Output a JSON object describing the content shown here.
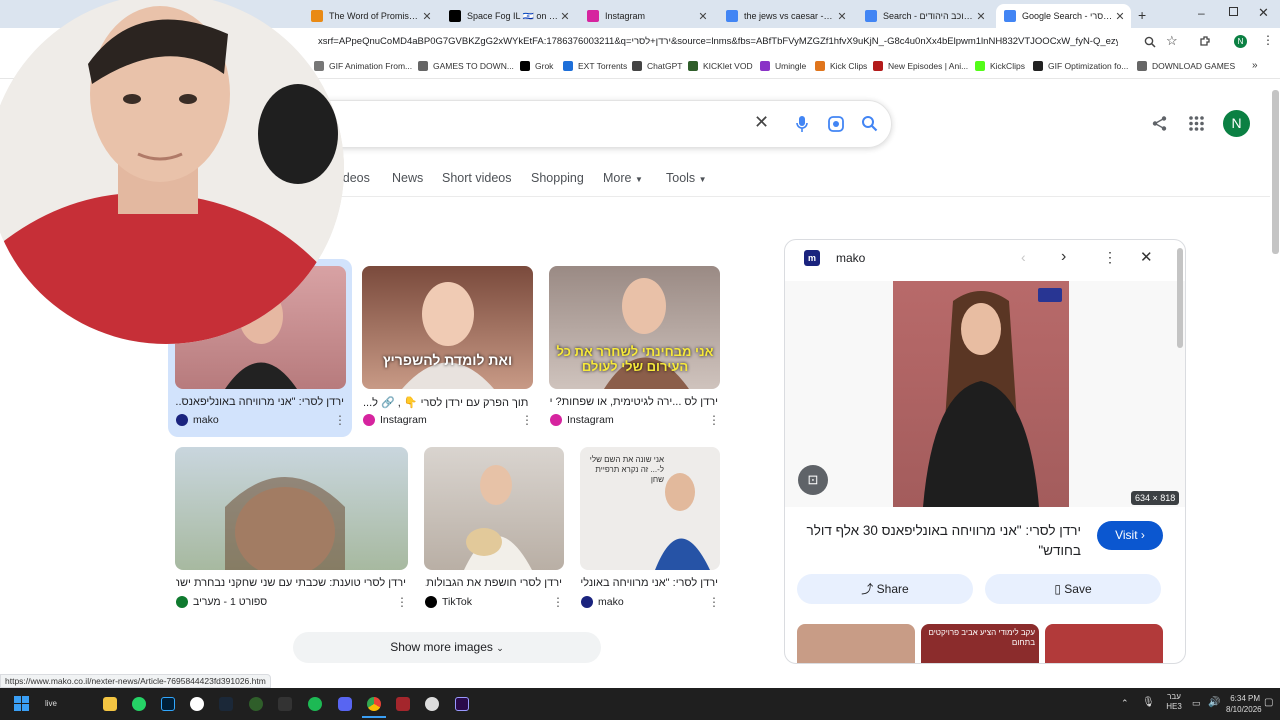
{
  "tabs": [
    {
      "title": "The Word of Promise Aud",
      "color": "#e98a15"
    },
    {
      "title": "Space Fog IL 🇮🇱 on X: \"3 ג",
      "color": "#000000"
    },
    {
      "title": "Instagram",
      "color": "#d6249f"
    },
    {
      "title": "the jews vs caesar - Goog",
      "color": "#4285f4"
    },
    {
      "title": "Search - הרוכב היהודים",
      "color": "#4285f4"
    },
    {
      "title": "Google Search - ירדן לסרי",
      "color": "#4285f4",
      "active": true
    }
  ],
  "address": {
    "url": "xsrf=APpeQnuCoMD4aBP0G7GVBKZgG2xWYkEtFA:1786376003211&q=ירדן+לסרי&source=lnms&fbs=ABfTbFVyMZGZf1hfvX9uKjN_-G8c4u0nXx4bElpwm1lnNH832VTJOOCxW_fyN-Q_ezyf8gLZhoVn..."
  },
  "bookmarks": [
    {
      "label": "GIF Animation From...",
      "color": "#777777"
    },
    {
      "label": "GAMES TO DOWN...",
      "color": "#666666"
    },
    {
      "label": "Grok",
      "color": "#000000"
    },
    {
      "label": "EXT Torrents",
      "color": "#1e6fd9"
    },
    {
      "label": "ChatGPT",
      "color": "#444444"
    },
    {
      "label": "KICKlet VOD",
      "color": "#2f5e2a"
    },
    {
      "label": "Umingle",
      "color": "#8a33c7"
    },
    {
      "label": "Kick Clips",
      "color": "#e0751c"
    },
    {
      "label": "New Episodes | Ani...",
      "color": "#b31b1b"
    },
    {
      "label": "KickClips",
      "color": "#53fc18"
    },
    {
      "label": "GIF Optimization fo...",
      "color": "#222222"
    },
    {
      "label": "DOWNLOAD GAMES",
      "color": "#666666"
    }
  ],
  "search_nav": [
    "ideos",
    "News",
    "Short videos",
    "Shopping",
    "More",
    "Tools"
  ],
  "avatar_letter": "N",
  "results_row1": [
    {
      "caption": "ירדן לסרי: \"אני מרוויחה באונליפאנס...",
      "source": "mako",
      "src_color": "#1a237e"
    },
    {
      "caption": "תוך הפרק עם ירדן לסרי 👇 , 🔗 ל...",
      "source": "Instagram",
      "src_color": "#d6249f"
    },
    {
      "caption": "ירדן לס ...ירה לגיטימית, או שפחות? ירדן לס",
      "source": "Instagram",
      "src_color": "#d6249f"
    }
  ],
  "results_row2": [
    {
      "caption": "ירדן לסרי טוענת: שכבתי עם שני שחקני נבחרת ישר...",
      "source": "ספורט 1 - מעריב",
      "src_color": "#0f7a2f"
    },
    {
      "caption": "ירדן לסרי חושפת את הגבולות...",
      "source": "TikTok",
      "src_color": "#000000"
    },
    {
      "caption": "ירדן לסרי: \"אני מרוויחה באונלי...",
      "source": "mako",
      "src_color": "#1a237e"
    }
  ],
  "thumb_overlays": {
    "t2": "ואת לומדת להשפריץ",
    "t3": "אני מבחינתי לשחרר את כל העירום שלי לעולם",
    "t6": "אני שונה את השם שלי ל-... זה נקרא תרפיית שחן"
  },
  "show_more_label": "Show more images",
  "panel": {
    "source": "mako",
    "dimensions": "634 × 818",
    "title": "ירדן לסרי: \"אני מרוויחה באונליפאנס 30 אלף דולר בחודש\"",
    "visit_label": "Visit",
    "share_label": "Share",
    "save_label": "Save",
    "related_overlay": "עקב לימודי הציע אביב פרויקטים בתחום"
  },
  "status_url": "https://www.mako.co.il/nexter-news/Article-7695844423fd391026.htm",
  "taskbar": {
    "lang": "עבר HE3",
    "time": "6:34 PM",
    "date": "8/10/2026"
  }
}
